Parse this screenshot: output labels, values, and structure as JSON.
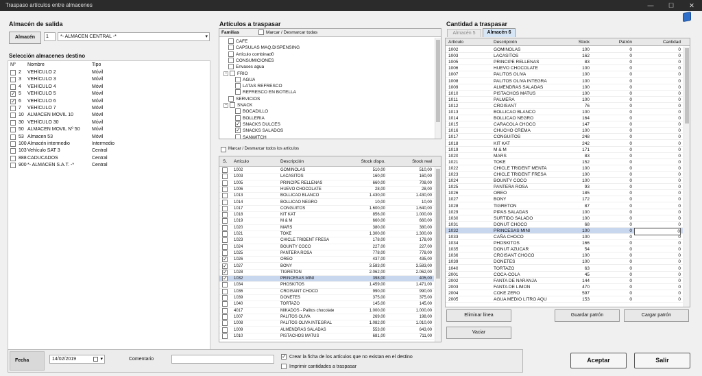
{
  "window": {
    "title": "Traspaso artículos entre almacenes",
    "min": "—",
    "max": "☐",
    "close": "✕"
  },
  "origen": {
    "title": "Almacén de salida",
    "button": "Almacén",
    "code": "1",
    "name": "*- ALMACEN CENTRAL -*"
  },
  "destinos": {
    "title": "Selección almacenes destino",
    "headers": [
      "Nº",
      "Nombre",
      "Tipo"
    ],
    "rows": [
      {
        "n": "2",
        "nombre": "VEHÍCULO 2",
        "tipo": "Móvil",
        "checked": false
      },
      {
        "n": "3",
        "nombre": "VEHÍCULO 3",
        "tipo": "Móvil",
        "checked": false
      },
      {
        "n": "4",
        "nombre": "VEHÍCULO 4",
        "tipo": "Móvil",
        "checked": false
      },
      {
        "n": "5",
        "nombre": "VEHÍCULO 5",
        "tipo": "Móvil",
        "checked": true
      },
      {
        "n": "6",
        "nombre": "VEHÍCULO 6",
        "tipo": "Móvil",
        "checked": true
      },
      {
        "n": "7",
        "nombre": "VEHÍCULO 7",
        "tipo": "Móvil",
        "checked": false
      },
      {
        "n": "10",
        "nombre": "ALMACEN MOVIL 10",
        "tipo": "Móvil",
        "checked": false
      },
      {
        "n": "30",
        "nombre": "VEHÍCULO 30",
        "tipo": "Móvil",
        "checked": false
      },
      {
        "n": "50",
        "nombre": "ALMACEN MOVIL Nº 50",
        "tipo": "Móvil",
        "checked": false
      },
      {
        "n": "53",
        "nombre": "Almacen 53",
        "tipo": "Móvil",
        "checked": false
      },
      {
        "n": "100",
        "nombre": "Almacén intermedio",
        "tipo": "Intermedio",
        "checked": false
      },
      {
        "n": "103",
        "nombre": "Vehículo SAT 3",
        "tipo": "Central",
        "checked": false
      },
      {
        "n": "888",
        "nombre": "CADUCADOS",
        "tipo": "Central",
        "checked": false
      },
      {
        "n": "900",
        "nombre": "*- ALMACEN S.A.T. -*",
        "tipo": "Central",
        "checked": false
      }
    ]
  },
  "articulos": {
    "title": "Artículos a traspasar",
    "familias_label": "Familias",
    "marcar_familias": "Marcar / Desmarcar todas",
    "familias": [
      {
        "label": "CAFE",
        "level": 0,
        "exp": false,
        "checked": false
      },
      {
        "label": "CAPSULAS MAQ.DISPENSING",
        "level": 0,
        "exp": false,
        "checked": false
      },
      {
        "label": "Artículo combinad0",
        "level": 0,
        "exp": false,
        "checked": false
      },
      {
        "label": "CONSUMICIONES",
        "level": 0,
        "exp": false,
        "checked": false
      },
      {
        "label": "Envases agua",
        "level": 0,
        "exp": false,
        "checked": false
      },
      {
        "label": "FRIO",
        "level": 0,
        "exp": true,
        "checked": false
      },
      {
        "label": "AGUA",
        "level": 1,
        "exp": false,
        "checked": false
      },
      {
        "label": "LATAS REFRESCO",
        "level": 1,
        "exp": false,
        "checked": false
      },
      {
        "label": "REFRESCO EN BOTELLA",
        "level": 1,
        "exp": false,
        "checked": false
      },
      {
        "label": "SERVICIOS",
        "level": 0,
        "exp": false,
        "checked": false
      },
      {
        "label": "SNACK",
        "level": 0,
        "exp": true,
        "checked": false
      },
      {
        "label": "BOCADILLO",
        "level": 1,
        "exp": false,
        "checked": false
      },
      {
        "label": "BOLLERIA",
        "level": 1,
        "exp": false,
        "checked": false
      },
      {
        "label": "SNACKS DULCES",
        "level": 1,
        "exp": false,
        "checked": true
      },
      {
        "label": "SNACKS SALADOS",
        "level": 1,
        "exp": false,
        "checked": true
      },
      {
        "label": "SANWITCH",
        "level": 1,
        "exp": false,
        "checked": false
      }
    ],
    "marcar_articulos": "Marcar / Desmarcar todos los artículos",
    "headers": [
      "S.",
      "Artículo",
      "Descripción",
      "Stock dispo.",
      "Stock real"
    ],
    "rows": [
      [
        "1002",
        "GOMINOLAS",
        "510,00",
        "510,00",
        false
      ],
      [
        "1003",
        "LACASITOS",
        "160,00",
        "160,00",
        false
      ],
      [
        "1005",
        "PRINCIPE RELLENAS",
        "660,00",
        "708,00",
        false
      ],
      [
        "1006",
        "HUEVO CHOCOLATE",
        "28,00",
        "28,00",
        false
      ],
      [
        "1013",
        "BOLLICAO BLANCO",
        "1.430,00",
        "1.430,00",
        false
      ],
      [
        "1014",
        "BOLLICAO NEGRO",
        "10,00",
        "10,00",
        false
      ],
      [
        "1017",
        "CONGUITOS",
        "1.600,00",
        "1.640,00",
        false
      ],
      [
        "1018",
        "KIT KAT",
        "856,00",
        "1.000,00",
        false
      ],
      [
        "1019",
        "M & M",
        "660,00",
        "660,00",
        false
      ],
      [
        "1020",
        "MARS",
        "380,00",
        "380,00",
        false
      ],
      [
        "1021",
        "TOKE",
        "1.300,00",
        "1.300,00",
        false
      ],
      [
        "1023",
        "CHICLE TRIDENT FRESA",
        "178,00",
        "178,00",
        false
      ],
      [
        "1024",
        "BOUNTY COCO",
        "227,00",
        "227,00",
        false
      ],
      [
        "1025",
        "PANTERA ROSA",
        "778,00",
        "778,00",
        false
      ],
      [
        "1026",
        "OREO",
        "437,00",
        "435,00",
        true
      ],
      [
        "1027",
        "BONY",
        "3.583,00",
        "3.583,00",
        true
      ],
      [
        "1028",
        "TIGRETON",
        "2.062,00",
        "2.062,00",
        true
      ],
      [
        "1032",
        "PRINCESAS MINI",
        "398,00",
        "405,00",
        true
      ],
      [
        "1034",
        "PHOSKITOS",
        "1.459,00",
        "1.471,00",
        false
      ],
      [
        "1036",
        "CROISANT CHOCO",
        "990,00",
        "990,00",
        false
      ],
      [
        "1039",
        "DONETES",
        "375,00",
        "375,00",
        false
      ],
      [
        "1040",
        "TORTAZO",
        "145,00",
        "145,00",
        false
      ],
      [
        "4017",
        "MIKADOS - Palitos chocolate",
        "1.000,00",
        "1.000,00",
        false
      ],
      [
        "1007",
        "PALITOS OLIVA",
        "269,00",
        "198,00",
        false
      ],
      [
        "1008",
        "PALITOS OLIVA INTEGRAL",
        "1.082,00",
        "1.010,00",
        false
      ],
      [
        "1009",
        "ALMENDRAS SALADAS",
        "553,00",
        "643,00",
        false
      ],
      [
        "1010",
        "PISTACHOS MATUS",
        "681,00",
        "711,00",
        false
      ]
    ]
  },
  "cantidad": {
    "title": "Cantidad a traspasar",
    "tabs": [
      "Almacén 5",
      "Almacén 6"
    ],
    "headers": [
      "Artículo",
      "Descripción",
      "Stock",
      "Patrón",
      "Cantidad"
    ],
    "rows": [
      [
        "1002",
        "GOMINOLAS",
        "100",
        "0",
        "0"
      ],
      [
        "1003",
        "LACASITOS",
        "162",
        "0",
        "0"
      ],
      [
        "1005",
        "PRINCIPE RELLENAS",
        "83",
        "0",
        "0"
      ],
      [
        "1006",
        "HUEVO CHOCOLATE",
        "100",
        "0",
        "0"
      ],
      [
        "1007",
        "PALITOS OLIVA",
        "100",
        "0",
        "0"
      ],
      [
        "1008",
        "PALITOS OLIVA INTEGRA",
        "100",
        "0",
        "0"
      ],
      [
        "1009",
        "ALMENDRAS SALADAS",
        "100",
        "0",
        "0"
      ],
      [
        "1010",
        "PISTACHOS MATUS",
        "100",
        "0",
        "0"
      ],
      [
        "1011",
        "PALMERA",
        "100",
        "0",
        "0"
      ],
      [
        "1012",
        "CROISANT",
        "76",
        "0",
        "0"
      ],
      [
        "1013",
        "BOLLICAO BLANCO",
        "100",
        "0",
        "0"
      ],
      [
        "1014",
        "BOLLICAO NEGRO",
        "164",
        "0",
        "0"
      ],
      [
        "1015",
        "CARACOLA CHOCO",
        "147",
        "0",
        "0"
      ],
      [
        "1016",
        "CHUCHO CREMA",
        "100",
        "0",
        "0"
      ],
      [
        "1017",
        "CONGUITOS",
        "248",
        "0",
        "0"
      ],
      [
        "1018",
        "KIT KAT",
        "242",
        "0",
        "0"
      ],
      [
        "1019",
        "M & M",
        "171",
        "0",
        "0"
      ],
      [
        "1020",
        "MARS",
        "83",
        "0",
        "0"
      ],
      [
        "1021",
        "TOKE",
        "152",
        "0",
        "0"
      ],
      [
        "1022",
        "CHICLE TRIDENT MENTA",
        "100",
        "0",
        "0"
      ],
      [
        "1023",
        "CHICLE TRIDENT FRESA",
        "100",
        "0",
        "0"
      ],
      [
        "1024",
        "BOUNTY COCO",
        "100",
        "0",
        "0"
      ],
      [
        "1025",
        "PANTERA ROSA",
        "93",
        "0",
        "0"
      ],
      [
        "1026",
        "OREO",
        "185",
        "0",
        "0"
      ],
      [
        "1027",
        "BONY",
        "172",
        "0",
        "0"
      ],
      [
        "1028",
        "TIGRETON",
        "87",
        "0",
        "0"
      ],
      [
        "1029",
        "PIPAS SALADAS",
        "100",
        "0",
        "0"
      ],
      [
        "1030",
        "SURTIDO SALADO",
        "100",
        "0",
        "0"
      ],
      [
        "1031",
        "DONUT CHOCO",
        "68",
        "0",
        "0"
      ],
      [
        "1032",
        "PRINCESAS MINI",
        "100",
        "0",
        "0"
      ],
      [
        "1033",
        "CAÑA CHOCO",
        "100",
        "0",
        "0"
      ],
      [
        "1034",
        "PHOSKITOS",
        "166",
        "0",
        "0"
      ],
      [
        "1035",
        "DONUT AZUCAR",
        "54",
        "0",
        "0"
      ],
      [
        "1036",
        "CROISANT CHOCO",
        "100",
        "0",
        "0"
      ],
      [
        "1039",
        "DONETES",
        "100",
        "0",
        "0"
      ],
      [
        "1040",
        "TORTAZO",
        "63",
        "0",
        "0"
      ],
      [
        "2001",
        "COCA-COLA",
        "45",
        "0",
        "0"
      ],
      [
        "2002",
        "FANTA DE NARANJA",
        "144",
        "0",
        "0"
      ],
      [
        "2003",
        "FANTA DE LIMON",
        "470",
        "0",
        "0"
      ],
      [
        "2004",
        "COKE ZERO",
        "597",
        "0",
        "0"
      ],
      [
        "2005",
        "AGUA MEDIO LITRO AQU",
        "153",
        "0",
        "0"
      ]
    ],
    "btn_eliminar": "Eliminar línea",
    "btn_vaciar": "Vaciar",
    "btn_guardar": "Guardar patrón",
    "btn_cargar": "Cargar patrón"
  },
  "footer": {
    "fecha_label": "Fecha",
    "fecha": "14/02/2019",
    "comentario_label": "Comentario",
    "crear_ficha": "Crear la ficha de los artículos que no existan en el destino",
    "imprimir": "Imprimir cantidades a traspasar",
    "aceptar": "Aceptar",
    "salir": "Salir"
  }
}
